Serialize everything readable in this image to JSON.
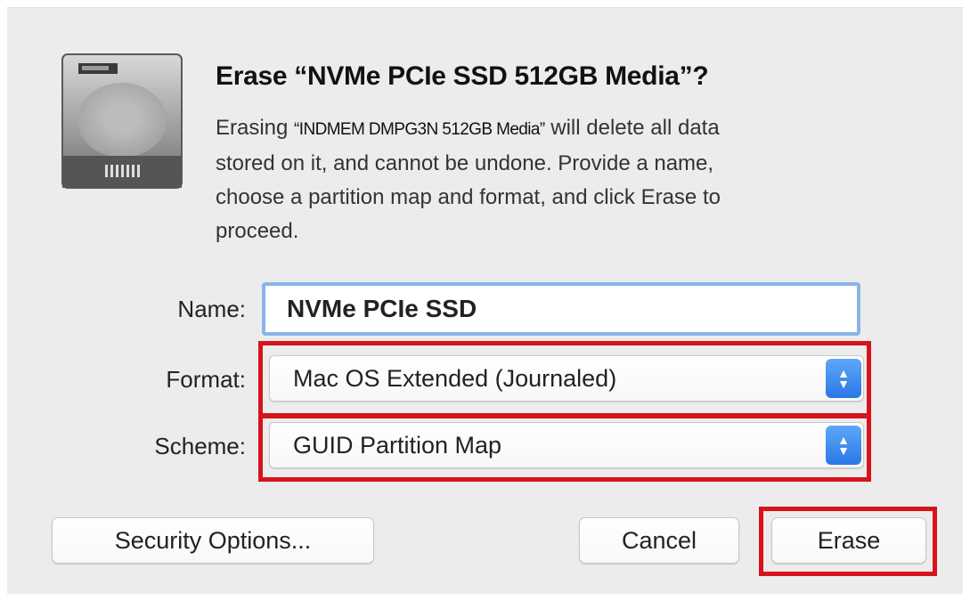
{
  "dialog": {
    "title": "Erase “NVMe PCIe SSD 512GB Media”?",
    "message": {
      "prefix": "Erasing ",
      "drive_name": "“INDMEM DMPG3N 512GB Media”",
      "line1_suffix": " will delete all data",
      "line2": "stored on it, and cannot be undone. Provide a name,",
      "line3": "choose a partition map and format, and click Erase to",
      "line4": "proceed."
    }
  },
  "form": {
    "name_label": "Name:",
    "name_value": "NVMe PCIe SSD",
    "format_label": "Format:",
    "format_value": "Mac OS Extended (Journaled)",
    "scheme_label": "Scheme:",
    "scheme_value": "GUID Partition Map"
  },
  "buttons": {
    "security_options": "Security Options...",
    "cancel": "Cancel",
    "erase": "Erase"
  },
  "colors": {
    "highlight": "#d7141b",
    "focus_ring": "#8ab4e8",
    "stepper": "#2a77e6"
  },
  "icons": {
    "drive": "hard-drive-icon",
    "stepper": "up-down-chevron-icon"
  }
}
